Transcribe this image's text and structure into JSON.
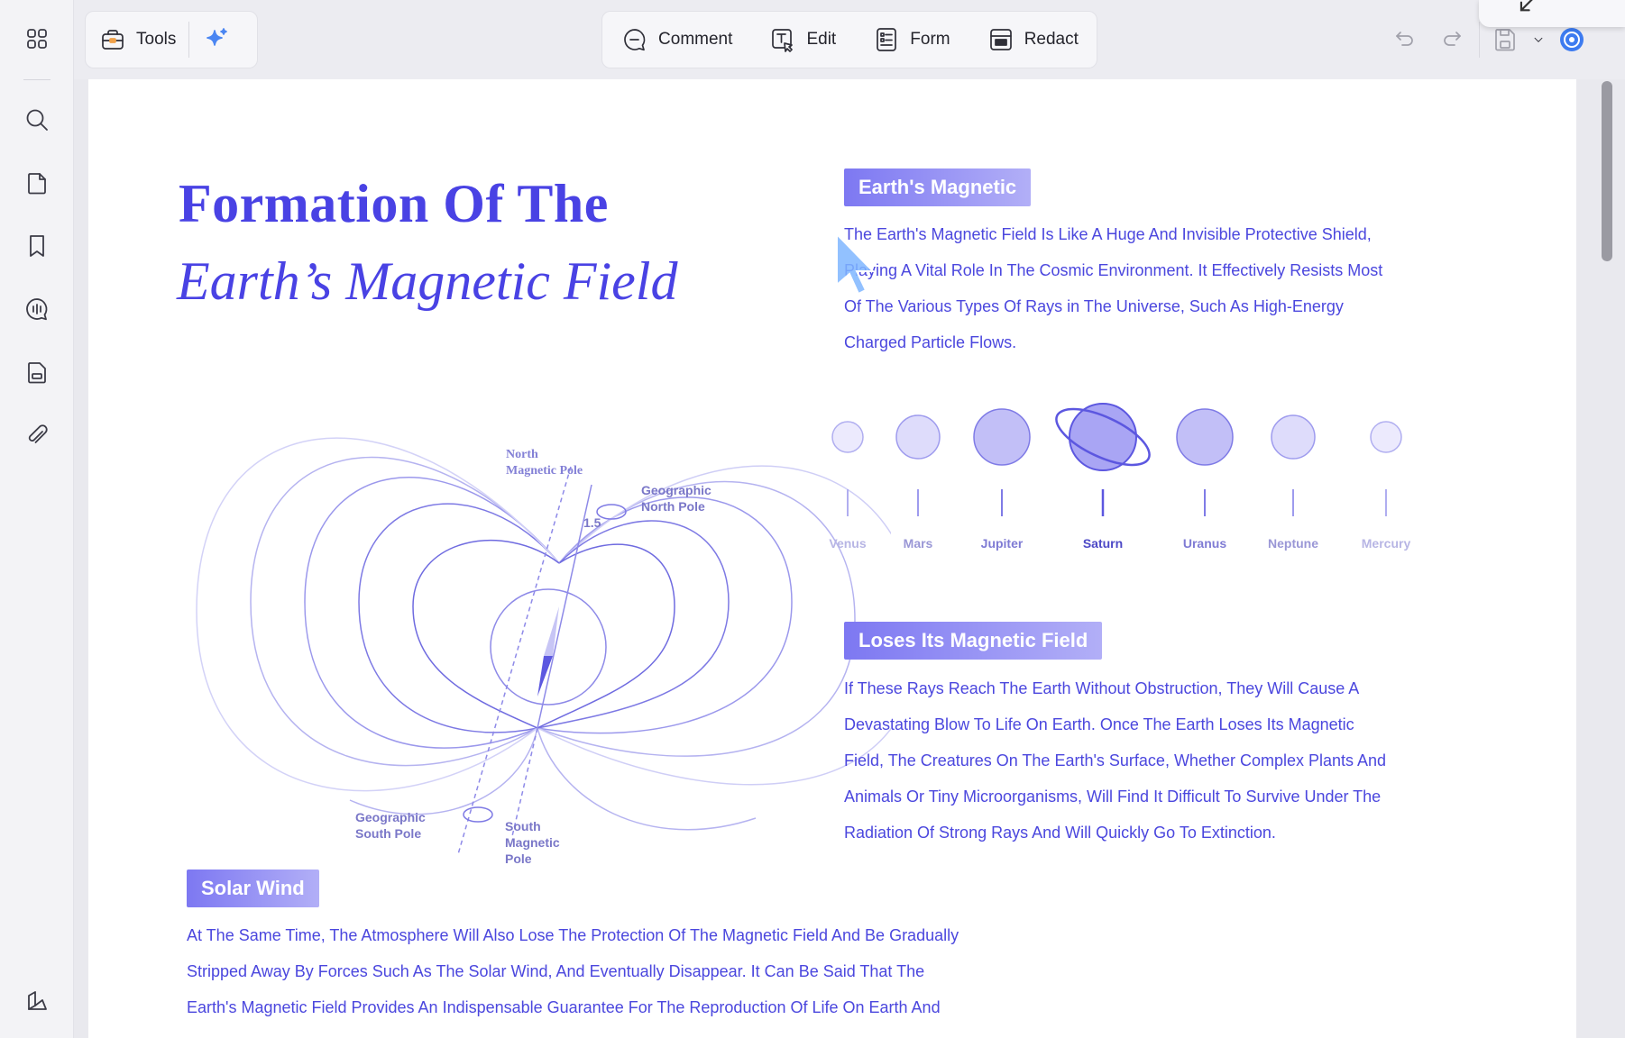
{
  "toolbar": {
    "tools_label": "Tools",
    "comment_label": "Comment",
    "edit_label": "Edit",
    "form_label": "Form",
    "redact_label": "Redact"
  },
  "rail": {
    "icons": [
      "grid-icon",
      "search-icon",
      "page-icon",
      "bookmark-icon",
      "comment-bubble-icon",
      "page-thumbnails-icon",
      "attachment-icon",
      "layers-icon"
    ]
  },
  "document": {
    "title_line1": "Formation Of The",
    "title_line2": "Earth’s Magnetic Field",
    "section1_tag": "Earth's Magnetic",
    "section1_text": [
      "The Earth's Magnetic Field Is Like A Huge And Invisible Protective Shield,",
      "Playing A Vital Role In The Cosmic Environment. It Effectively Resists Most",
      "Of The Various Types Of Rays in The Universe, Such As High-Energy",
      "Charged Particle Flows."
    ],
    "planets": [
      "Venus",
      "Mars",
      "Jupiter",
      "Saturn",
      "Uranus",
      "Neptune",
      "Mercury"
    ],
    "section2_tag": "Loses Its Magnetic Field",
    "section2_text": [
      "If These Rays Reach The Earth Without Obstruction, They Will Cause A",
      "Devastating Blow To Life On Earth. Once The Earth Loses Its Magnetic",
      "Field, The Creatures On The Earth's Surface, Whether Complex Plants And",
      "Animals Or Tiny Microorganisms, Will Find It Difficult To Survive Under The",
      "Radiation Of Strong Rays And Will Quickly Go To Extinction."
    ],
    "section3_tag": "Solar Wind",
    "section3_text": [
      "At The Same Time, The Atmosphere Will Also Lose The Protection Of The Magnetic Field And Be Gradually",
      "Stripped Away By Forces Such As The Solar Wind, And Eventually Disappear. It Can Be Said That The",
      "Earth's Magnetic Field Provides An Indispensable Guarantee For The Reproduction Of Life On Earth And"
    ],
    "diagram": {
      "north_magnetic": [
        "North",
        "Magnetic Pole"
      ],
      "geo_north": [
        "Geographic",
        "North Pole"
      ],
      "angle": "1.5",
      "geo_south": [
        "Geographic",
        "South Pole"
      ],
      "south_magnetic": [
        "South",
        "Magnetic",
        "Pole"
      ]
    }
  },
  "colors": {
    "accent": "#4a46e0",
    "tag_start": "#7d78f2",
    "tag_end": "#b2aff7"
  }
}
